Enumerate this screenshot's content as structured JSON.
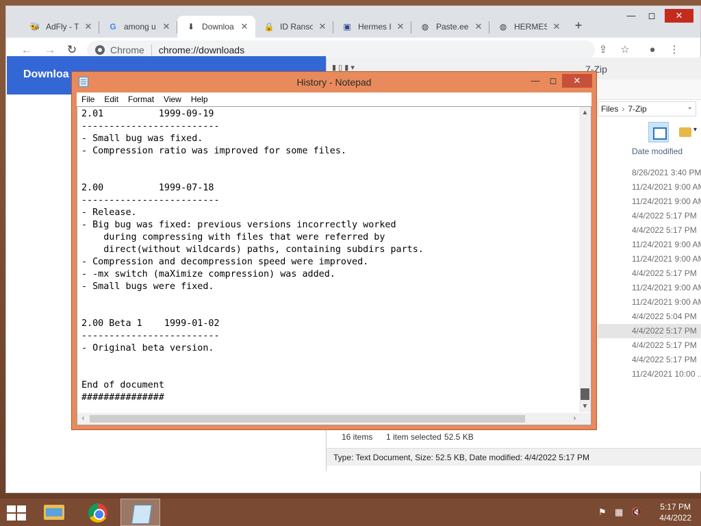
{
  "chrome": {
    "tabs": [
      {
        "title": "AdFly - T",
        "icon": "adfly-icon",
        "glyph": "🐝"
      },
      {
        "title": "among u",
        "icon": "google-icon",
        "glyph": "G"
      },
      {
        "title": "Downloa",
        "icon": "download-icon",
        "glyph": "⬇"
      },
      {
        "title": "ID Ranso",
        "icon": "lock-icon",
        "glyph": "🔒"
      },
      {
        "title": "Hermes I",
        "icon": "site-icon",
        "glyph": "▣"
      },
      {
        "title": "Paste.ee",
        "icon": "globe-icon",
        "glyph": "◍"
      },
      {
        "title": "HERMES",
        "icon": "globe-icon",
        "glyph": "◍"
      }
    ],
    "tab_close": "✕",
    "new_tab": "+",
    "omnibox_label": "Chrome",
    "url": "chrome://downloads",
    "page_title": "Downloa"
  },
  "explorer": {
    "title": "7-Zip",
    "breadcrumb": [
      "Files",
      "7-Zip"
    ],
    "column_header": "Date modified",
    "rows": [
      "8/26/2021 3:40 PM",
      "11/24/2021 9:00 AM",
      "11/24/2021 9:00 AM",
      "4/4/2022 5:17 PM",
      "4/4/2022 5:17 PM",
      "11/24/2021 9:00 AM",
      "11/24/2021 9:00 AM",
      "4/4/2022 5:17 PM",
      "11/24/2021 9:00 AM",
      "11/24/2021 9:00 AM",
      "4/4/2022 5:04 PM",
      "4/4/2022 5:17 PM",
      "4/4/2022 5:17 PM",
      "4/4/2022 5:17 PM",
      "11/24/2021 10:00 ..."
    ],
    "selected_row": 11,
    "status": {
      "items": "16 items",
      "selected": "1 item selected",
      "size": "52.5 KB"
    },
    "details": "Type: Text Document, Size: 52.5 KB, Date modified: 4/4/2022 5:17 PM"
  },
  "notepad": {
    "title": "History - Notepad",
    "menu": [
      "File",
      "Edit",
      "Format",
      "View",
      "Help"
    ],
    "content": "2.01          1999-09-19\n-------------------------\n- Small bug was fixed.\n- Compression ratio was improved for some files.\n\n\n2.00          1999-07-18\n-------------------------\n- Release.\n- Big bug was fixed: previous versions incorrectly worked\n    during compressing with files that were referred by\n    direct(without wildcards) paths, containing subdirs parts.\n- Compression and decompression speed were improved.\n- -mx switch (maXimize compression) was added.\n- Small bugs were fixed.\n\n\n2.00 Beta 1    1999-01-02\n-------------------------\n- Original beta version.\n\n\nEnd of document\n###############"
  },
  "taskbar": {
    "time": "5:17 PM",
    "date": "4/4/2022"
  }
}
